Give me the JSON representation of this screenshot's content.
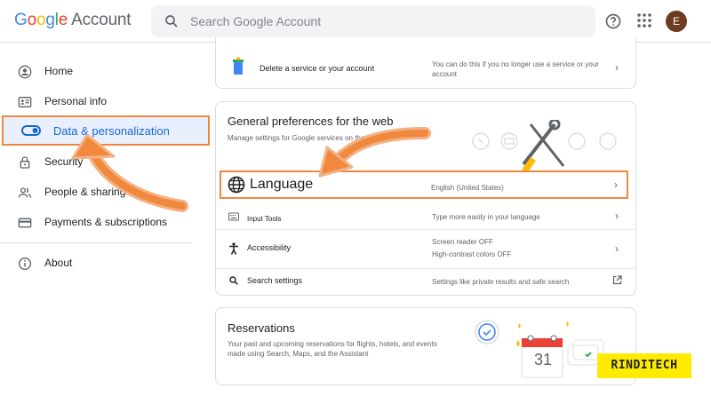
{
  "header": {
    "logo_google": "Google",
    "logo_account": "Account",
    "search_placeholder": "Search Google Account",
    "avatar_initial": "E"
  },
  "sidebar": {
    "items": [
      {
        "label": "Home",
        "icon": "person-circle-icon"
      },
      {
        "label": "Personal info",
        "icon": "id-card-icon"
      },
      {
        "label": "Data & personalization",
        "icon": "toggle-icon",
        "active": true
      },
      {
        "label": "Security",
        "icon": "lock-icon"
      },
      {
        "label": "People & sharing",
        "icon": "people-icon"
      },
      {
        "label": "Payments & subscriptions",
        "icon": "credit-card-icon"
      },
      {
        "label": "About",
        "icon": "info-icon"
      }
    ]
  },
  "delete_card": {
    "label": "Delete a service or your account",
    "desc": "You can do this if you no longer use a service or your account"
  },
  "prefs_card": {
    "title": "General preferences for the web",
    "subtitle": "Manage settings for Google services on the web",
    "rows": [
      {
        "label": "Language",
        "desc": "English (United States)",
        "icon": "globe-icon"
      },
      {
        "label": "Input Tools",
        "desc": "Type more easily in your language",
        "icon": "keyboard-icon"
      },
      {
        "label": "Accessibility",
        "desc": "Screen reader OFF",
        "desc2": "High-contrast colors OFF",
        "icon": "accessibility-icon"
      },
      {
        "label": "Search settings",
        "desc": "Settings like private results and safe search",
        "icon": "search-icon"
      }
    ]
  },
  "reservations_card": {
    "title": "Reservations",
    "desc": "Your past and upcoming reservations for flights, hotels, and events made using Search, Maps, and the Assistant",
    "calendar_day": "31"
  },
  "watermark": "RINDITECH",
  "colors": {
    "accent": "#1967d2",
    "highlight": "#f0883e",
    "badge": "#ffeb00"
  }
}
